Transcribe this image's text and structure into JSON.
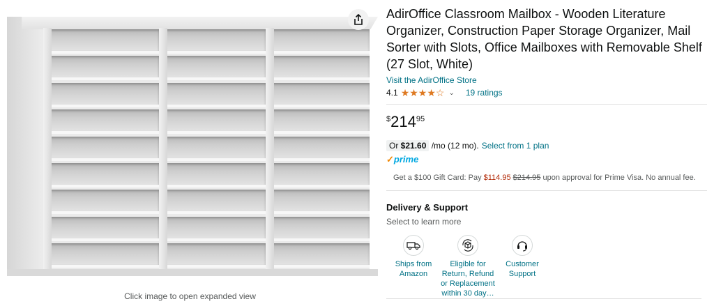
{
  "image": {
    "caption": "Click image to open expanded view",
    "share_icon": "share-icon"
  },
  "product": {
    "title": "AdirOffice Classroom Mailbox - Wooden Literature Organizer, Construction Paper Storage Organizer, Mail Sorter with Slots, Office Mailboxes with Removable Shelf (27 Slot, White)",
    "store_link": "Visit the AdirOffice Store",
    "rating": "4.1",
    "stars": "★★★★☆",
    "rating_count": "19 ratings"
  },
  "price": {
    "symbol": "$",
    "whole": "214",
    "fraction": "95"
  },
  "installment": {
    "prefix": "Or ",
    "amount": "$21.60",
    "term": " /mo (12 mo).",
    "plan_link": "Select from 1 plan"
  },
  "prime": {
    "check": "✓",
    "label": "prime"
  },
  "gift_card": {
    "prefix": "Get a $100 Gift Card: Pay ",
    "new_price": "$114.95",
    "old_price": "$214.95",
    "suffix": " upon approval for Prime Visa. No annual fee."
  },
  "delivery": {
    "heading": "Delivery & Support",
    "subheading": "Select to learn more",
    "items": [
      {
        "label": "Ships from Amazon",
        "icon": "truck-icon"
      },
      {
        "label": "Eligible for Return, Refund or Replacement within 30 day…",
        "icon": "return-box-icon"
      },
      {
        "label": "Customer Support",
        "icon": "headset-icon"
      }
    ]
  },
  "colors": {
    "link": "#007185",
    "star": "#de7921",
    "prime": "#00a8e1",
    "price_red": "#b12704"
  }
}
